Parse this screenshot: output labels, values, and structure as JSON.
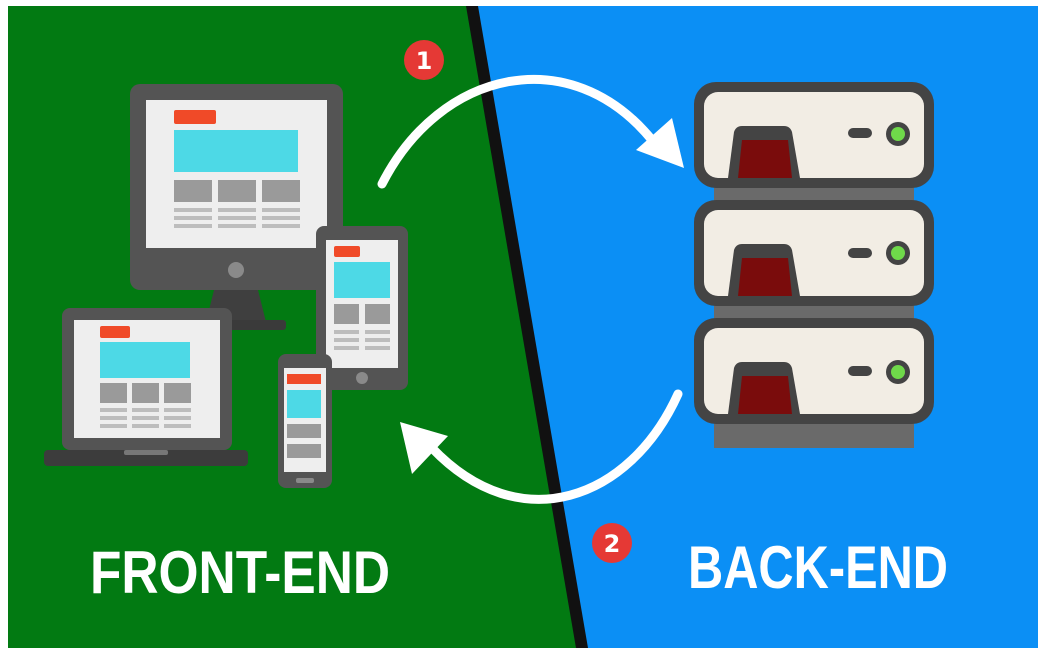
{
  "labels": {
    "left": "FRONT-END",
    "right": "BACK-END"
  },
  "badges": {
    "step1": "1",
    "step2": "2"
  },
  "colors": {
    "frontend_bg": "#027a12",
    "backend_bg": "#0b8ff5",
    "divider": "#111111",
    "badge": "#e53935",
    "arrow": "#ffffff",
    "screen_accent": "#4dd9e6",
    "ui_red": "#f04a28",
    "server_body": "#f2ede4",
    "server_dark": "#5a5a5a",
    "server_led": "#6fd94a",
    "server_slot": "#7a0c0c"
  },
  "icons": {
    "frontend_devices": [
      "desktop-monitor-icon",
      "laptop-icon",
      "tablet-icon",
      "phone-icon"
    ],
    "backend": "server-rack-icon"
  }
}
